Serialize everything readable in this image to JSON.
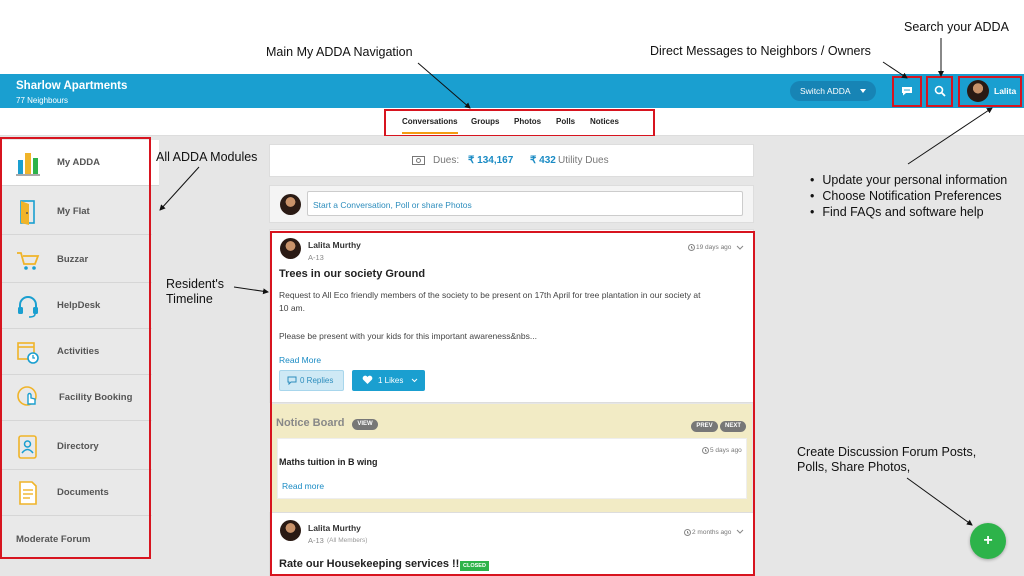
{
  "callouts": {
    "main_nav": "Main My ADDA Navigation",
    "direct_messages": "Direct Messages to Neighbors / Owners",
    "search": "Search your ADDA",
    "modules": "All ADDA Modules",
    "timeline_line1": "Resident's",
    "timeline_line2": "Timeline",
    "bullets": [
      "Update your personal information",
      "Choose Notification Preferences",
      "Find FAQs and software help"
    ],
    "create_line1": "Create Discussion Forum Posts,",
    "create_line2": "Polls, Share Photos,"
  },
  "header": {
    "title": "Sharlow Apartments",
    "subtitle": "77 Neighbours",
    "switch_label": "Switch ADDA",
    "user_name": "Lalita",
    "chat_icon": "chat-icon",
    "search_icon": "search-icon"
  },
  "tabs": [
    {
      "label": "Conversations",
      "active": true
    },
    {
      "label": "Groups"
    },
    {
      "label": "Photos"
    },
    {
      "label": "Polls"
    },
    {
      "label": "Notices"
    }
  ],
  "sidebar": {
    "items": [
      {
        "label": "My ADDA",
        "icon": "city-icon",
        "active": true
      },
      {
        "label": "My Flat",
        "icon": "door-icon"
      },
      {
        "label": "Buzzar",
        "icon": "cart-icon"
      },
      {
        "label": "HelpDesk",
        "icon": "headset-icon"
      },
      {
        "label": "Activities",
        "icon": "calendar-clock-icon"
      },
      {
        "label": "Facility Booking",
        "icon": "hand-pointer-icon"
      },
      {
        "label": "Directory",
        "icon": "contact-book-icon"
      },
      {
        "label": "Documents",
        "icon": "document-icon"
      }
    ],
    "moderate": "Moderate Forum"
  },
  "dues": {
    "label": "Dues:",
    "amount": "₹ 134,167",
    "utility_amount": "₹ 432",
    "utility_label": "Utility Dues"
  },
  "composer": {
    "placeholder": "Start a Conversation, Poll or share Photos"
  },
  "post1": {
    "author": "Lalita Murthy",
    "flat": "A-13",
    "time": "19 days ago",
    "title": "Trees in our society Ground",
    "body_line1": "Request to All Eco friendly members of the society to be present on 17th April for tree plantation in our society at",
    "body_line2": "10 am.",
    "body_line3": "Please be present with your kids for this important awareness&nbs...",
    "read_more": "Read More",
    "replies": "0 Replies",
    "likes": "1 Likes"
  },
  "notice_board": {
    "title": "Notice Board",
    "view": "VIEW",
    "prev": "PREV",
    "next": "NEXT",
    "time": "5 days ago",
    "item_title": "Maths tuition in B wing",
    "read_more": "Read more"
  },
  "post2": {
    "author": "Lalita Murthy",
    "flat": "A-13",
    "audience": "(All Members)",
    "time": "2 months ago",
    "title": "Rate our Housekeeping services !!",
    "badge": "CLOSED"
  },
  "fab": {
    "label": "+"
  },
  "colors": {
    "brand": "#1a9fd0",
    "highlight": "#d7141f",
    "fab": "#2db34a",
    "active_tab": "#f39c12"
  }
}
